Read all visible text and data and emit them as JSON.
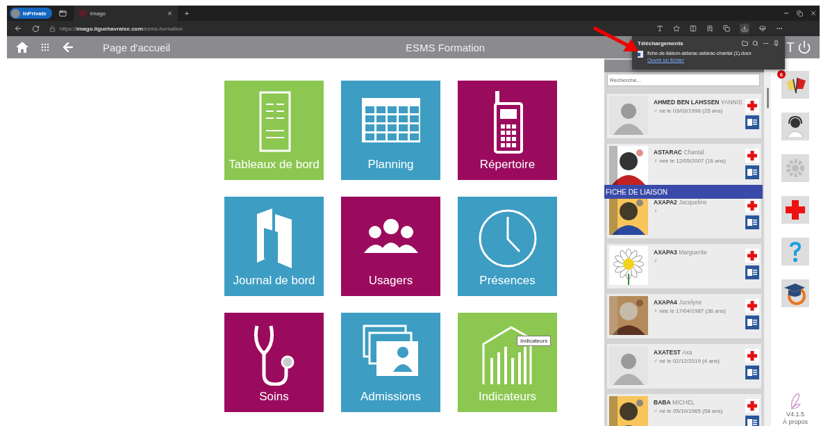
{
  "browser": {
    "profile": "InPrivate",
    "tab": {
      "title": "Imago",
      "close": "×"
    },
    "new_tab": "+",
    "url": {
      "scheme": "https://",
      "host": "imago.liguehavraise.com",
      "path": "/esms-formation"
    }
  },
  "header": {
    "page_title": "Page d'accueil",
    "app_title": "ESMS Formation",
    "user_initial": "T"
  },
  "tiles": [
    {
      "label": "Tableaux de bord",
      "color": "#8cc751",
      "kind": "document"
    },
    {
      "label": "Planning",
      "color": "#3d9dc3",
      "kind": "calendar"
    },
    {
      "label": "Répertoire",
      "color": "#9b0b5d",
      "kind": "phone"
    },
    {
      "label": "Journal de bord",
      "color": "#3d9dc3",
      "kind": "book"
    },
    {
      "label": "Usagers",
      "color": "#9b0b5d",
      "kind": "people"
    },
    {
      "label": "Présences",
      "color": "#3d9dc3",
      "kind": "clock"
    },
    {
      "label": "Soins",
      "color": "#9b0b5d",
      "kind": "stethoscope"
    },
    {
      "label": "Admissions",
      "color": "#3d9dc3",
      "kind": "cards"
    },
    {
      "label": "Indicateurs",
      "color": "#8cc751",
      "kind": "chart",
      "tooltip": "Indicateurs"
    }
  ],
  "patients": {
    "search_placeholder": "Recherche...",
    "items": [
      {
        "last_name": "AHMED BEN LAHSSEN",
        "first_name": "YANNIS",
        "sex": "♂",
        "birth": "né le 03/03/1998 (25 ans)",
        "avatar": {
          "kind": "silhouette"
        }
      },
      {
        "last_name": "ASTARAC",
        "first_name": "Chantal",
        "sex": "♀",
        "birth": "née le 12/05/2007 (16 ans)"
      },
      {
        "last_name": "AXAPA2",
        "first_name": "Jacqueline",
        "sex": "♀"
      },
      {
        "last_name": "AXAPA3",
        "first_name": "Marguerite",
        "sex": "♀",
        "avatar": {
          "kind": "flower"
        }
      },
      {
        "last_name": "AXAPA4",
        "first_name": "Jocelyne",
        "sex": "♀",
        "birth": "née le 17/04/1987 (36 ans)"
      },
      {
        "last_name": "AXATEST",
        "first_name": "Axa",
        "sex": "♂",
        "birth": "né le 02/12/2019 (4 ans)",
        "avatar": {
          "kind": "silhouette"
        }
      },
      {
        "last_name": "BABA",
        "first_name": "MICHEL",
        "sex": "♂",
        "birth": "né le 05/10/1965 (58 ans)"
      }
    ]
  },
  "overlay_bar": "FICHE DE LIAISON",
  "side_tools": [
    {
      "kind": "flags",
      "badge": "6"
    },
    {
      "kind": "support"
    },
    {
      "kind": "settings"
    },
    {
      "kind": "first-aid"
    },
    {
      "kind": "help"
    },
    {
      "kind": "e-learning"
    }
  ],
  "footer": {
    "version": "V4.1.5",
    "about": "À propos"
  },
  "downloads": {
    "title": "Téléchargements",
    "file": "fiche-de-liaison-astarac-astarac-chantal (1).docx",
    "link": "Ouvrir un fichier"
  }
}
